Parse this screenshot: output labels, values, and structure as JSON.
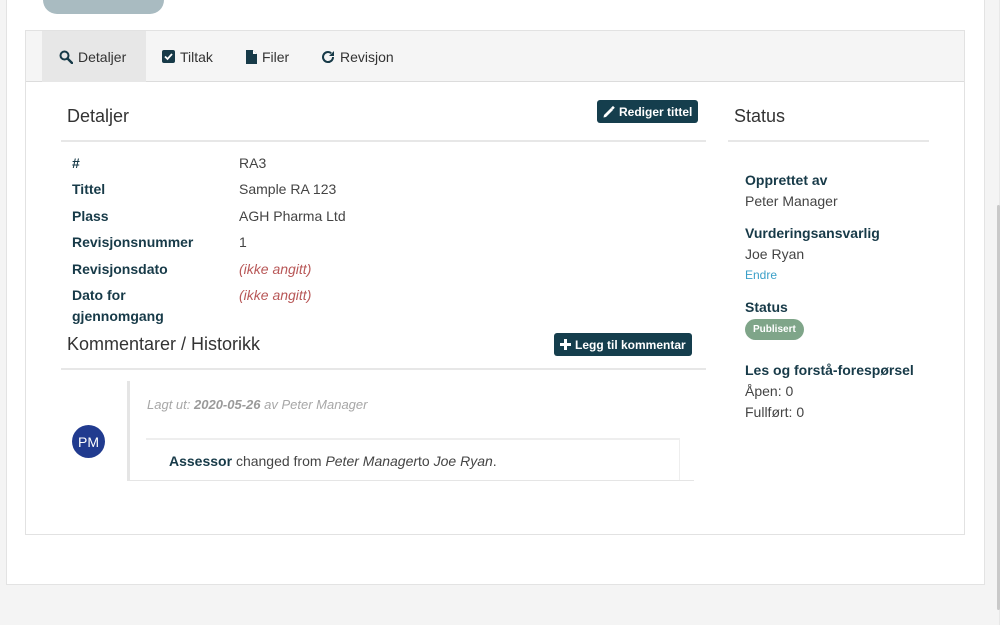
{
  "tabs": [
    {
      "label": "Detaljer",
      "icon": "search-icon",
      "active": true
    },
    {
      "label": "Tiltak",
      "icon": "check-square-icon"
    },
    {
      "label": "Filer",
      "icon": "file-icon"
    },
    {
      "label": "Revisjon",
      "icon": "refresh-icon"
    }
  ],
  "details": {
    "title": "Detaljer",
    "edit_button": "Rediger tittel",
    "rows": [
      {
        "label": "#",
        "value": "RA3"
      },
      {
        "label": "Tittel",
        "value": "Sample RA 123"
      },
      {
        "label": "Plass",
        "value": "AGH Pharma Ltd"
      },
      {
        "label": "Revisjonsnummer",
        "value": "1"
      },
      {
        "label": "Revisjonsdato",
        "value": "(ikke angitt)"
      },
      {
        "label": "Dato for gjennomgang",
        "value": "(ikke angitt)"
      }
    ]
  },
  "comments": {
    "title": "Kommentarer / Historikk",
    "add_button": "Legg til kommentar",
    "entry": {
      "avatar": "PM",
      "meta_prefix": "Lagt ut:",
      "date": "2020-05-26",
      "meta_suffix": "av Peter Manager",
      "field": "Assessor",
      "changed_from": "changed from",
      "from_value": "Peter Manager",
      "to_word": "to",
      "to_value": "Joe Ryan",
      "end": "."
    }
  },
  "status": {
    "title": "Status",
    "created_by_label": "Opprettet av",
    "created_by": "Peter Manager",
    "assessor_label": "Vurderingsansvarlig",
    "assessor": "Joe Ryan",
    "change_link": "Endre",
    "status_label": "Status",
    "status_badge": "Publisert",
    "read_label": "Les og forstå-forespørsel",
    "open": "Åpen: 0",
    "done": "Fullført: 0"
  },
  "colors": {
    "primary_button": "#153e4d",
    "badge": "#7fa589",
    "avatar": "#213b8f",
    "link": "#3a9fc8",
    "missing_value": "#b85757"
  }
}
